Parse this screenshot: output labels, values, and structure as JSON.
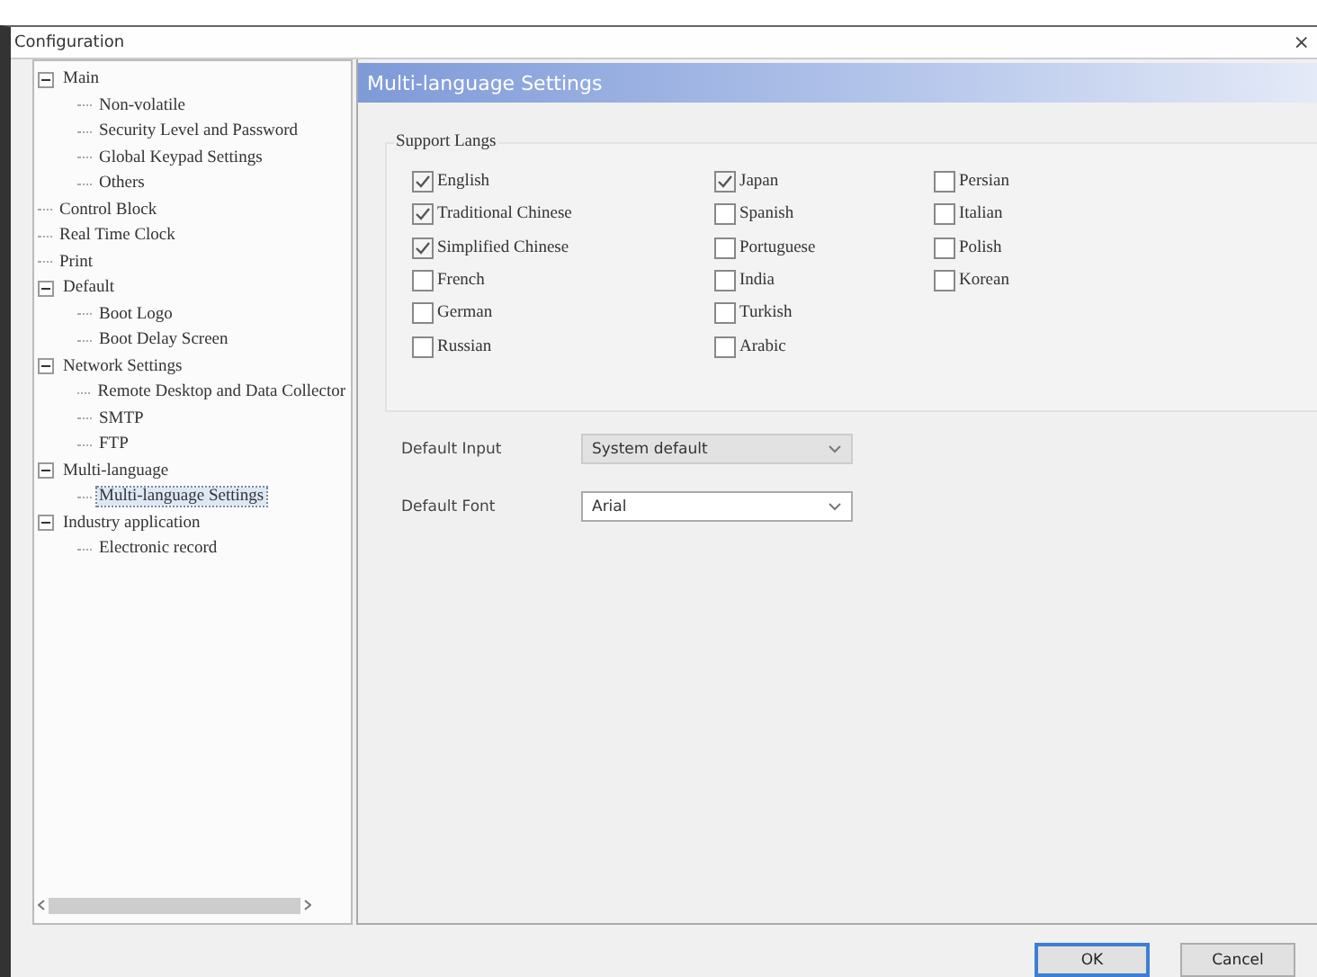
{
  "window": {
    "title": "Configuration",
    "close": "×"
  },
  "tree": [
    {
      "label": "Main",
      "expanded": true,
      "selected": false,
      "children": [
        {
          "label": "Non-volatile",
          "selected": false
        },
        {
          "label": "Security Level and Password",
          "selected": false
        },
        {
          "label": "Global Keypad Settings",
          "selected": false
        },
        {
          "label": "Others",
          "selected": false
        }
      ]
    },
    {
      "label": "Control Block",
      "selected": false
    },
    {
      "label": "Real Time Clock",
      "selected": false
    },
    {
      "label": "Print",
      "selected": false
    },
    {
      "label": "Default",
      "expanded": true,
      "selected": false,
      "children": [
        {
          "label": "Boot Logo",
          "selected": false
        },
        {
          "label": "Boot Delay Screen",
          "selected": false
        }
      ]
    },
    {
      "label": "Network Settings",
      "expanded": true,
      "selected": false,
      "children": [
        {
          "label": "Remote Desktop and Data Collector",
          "selected": false
        },
        {
          "label": "SMTP",
          "selected": false
        },
        {
          "label": "FTP",
          "selected": false
        }
      ]
    },
    {
      "label": "Multi-language",
      "expanded": true,
      "selected": false,
      "children": [
        {
          "label": "Multi-language Settings",
          "selected": true
        }
      ]
    },
    {
      "label": "Industry application",
      "expanded": true,
      "selected": false,
      "children": [
        {
          "label": "Electronic record",
          "selected": false
        }
      ]
    }
  ],
  "panel": {
    "title": "Multi-language Settings",
    "group_title": "Support Langs",
    "languages": [
      [
        {
          "label": "English",
          "checked": true
        },
        {
          "label": "Traditional Chinese",
          "checked": true
        },
        {
          "label": "Simplified Chinese",
          "checked": true
        },
        {
          "label": "French",
          "checked": false
        },
        {
          "label": "German",
          "checked": false
        },
        {
          "label": "Russian",
          "checked": false
        }
      ],
      [
        {
          "label": "Japan",
          "checked": true
        },
        {
          "label": "Spanish",
          "checked": false
        },
        {
          "label": "Portuguese",
          "checked": false
        },
        {
          "label": "India",
          "checked": false
        },
        {
          "label": "Turkish",
          "checked": false
        },
        {
          "label": "Arabic",
          "checked": false
        }
      ],
      [
        {
          "label": "Persian",
          "checked": false
        },
        {
          "label": "Italian",
          "checked": false
        },
        {
          "label": "Polish",
          "checked": false
        },
        {
          "label": "Korean",
          "checked": false
        }
      ]
    ],
    "fields": [
      {
        "label": "Default Input",
        "value": "System default",
        "disabled": true
      },
      {
        "label": "Default Font",
        "value": "Arial",
        "disabled": false
      }
    ]
  },
  "buttons": [
    {
      "label": "OK",
      "default": true
    },
    {
      "label": "Cancel",
      "default": false
    }
  ]
}
